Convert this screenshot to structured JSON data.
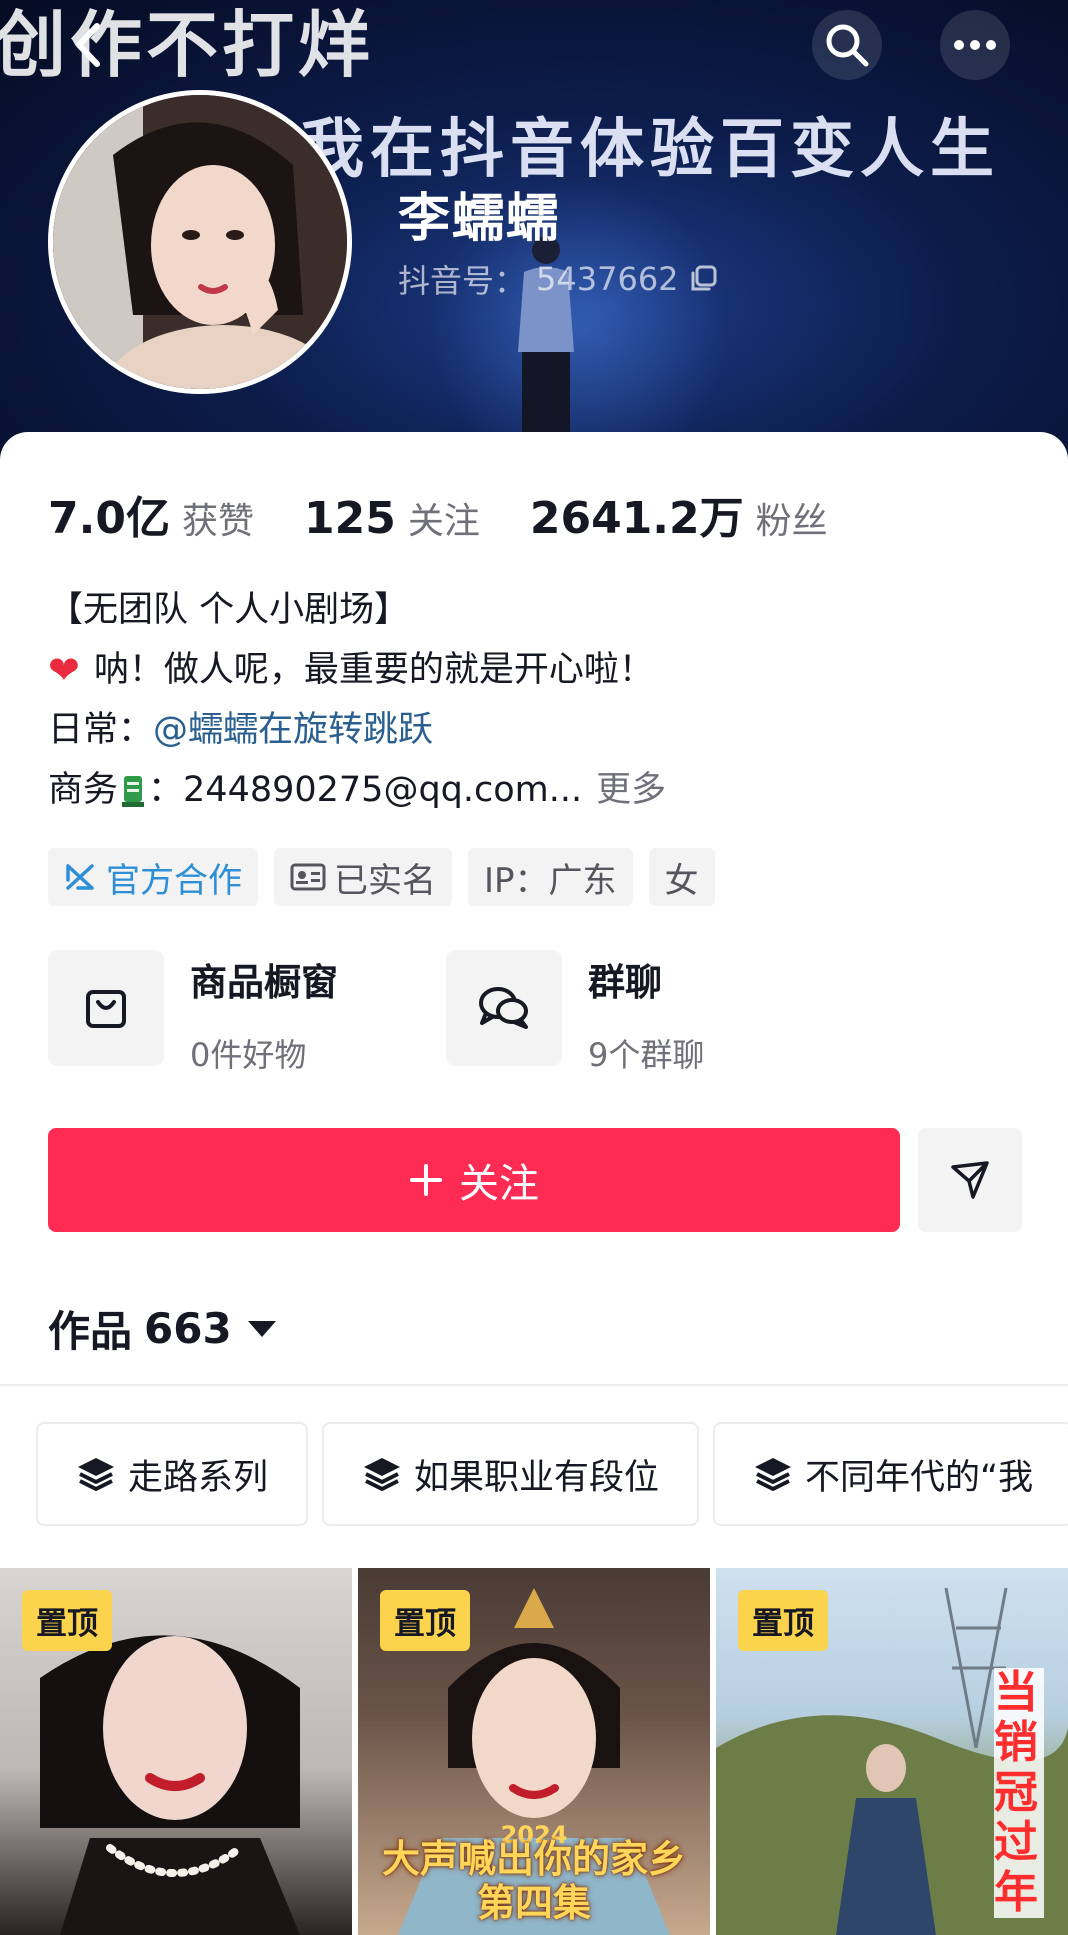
{
  "header": {
    "banner_text_top": "创作不打烊",
    "banner_text_main": "我在抖音体验百变人生",
    "name": "李蠕蠕",
    "douyin_id_label": "抖音号：",
    "douyin_id": "5437662"
  },
  "stats": [
    {
      "value": "7.0亿",
      "label": "获赞"
    },
    {
      "value": "125",
      "label": "关注"
    },
    {
      "value": "2641.2万",
      "label": "粉丝"
    }
  ],
  "bio": {
    "line1": "【无团队 个人小剧场】",
    "line2": "呐！做人呢，最重要的就是开心啦！",
    "daily_label": "日常：",
    "daily_link": "@蠕蠕在旋转跳跃",
    "business_label": "商务",
    "business_sep": "：",
    "business_email": "244890275@qq.com...",
    "more": "更多"
  },
  "tags": [
    {
      "label": "官方合作",
      "icon": "official-coop-icon"
    },
    {
      "label": "已实名",
      "icon": "id-card-icon"
    },
    {
      "label": "IP：广东"
    },
    {
      "label": "女"
    }
  ],
  "features": {
    "shop": {
      "title": "商品橱窗",
      "sub": "0件好物"
    },
    "group": {
      "title": "群聊",
      "sub": "9个群聊"
    }
  },
  "actions": {
    "follow_label": "关注"
  },
  "works": {
    "label": "作品",
    "count": "663"
  },
  "collections": [
    "走路系列",
    "如果职业有段位",
    "不同年代的“我"
  ],
  "videos": [
    {
      "pin": "置顶"
    },
    {
      "pin": "置顶",
      "year": "2024",
      "caption": "大声喊出你的家乡",
      "caption2": "第四集"
    },
    {
      "pin": "置顶",
      "vertical": "当销冠过年"
    }
  ],
  "colors": {
    "accent": "#fe2c55",
    "link": "#2a5f8f",
    "pin": "#fbd34c"
  }
}
